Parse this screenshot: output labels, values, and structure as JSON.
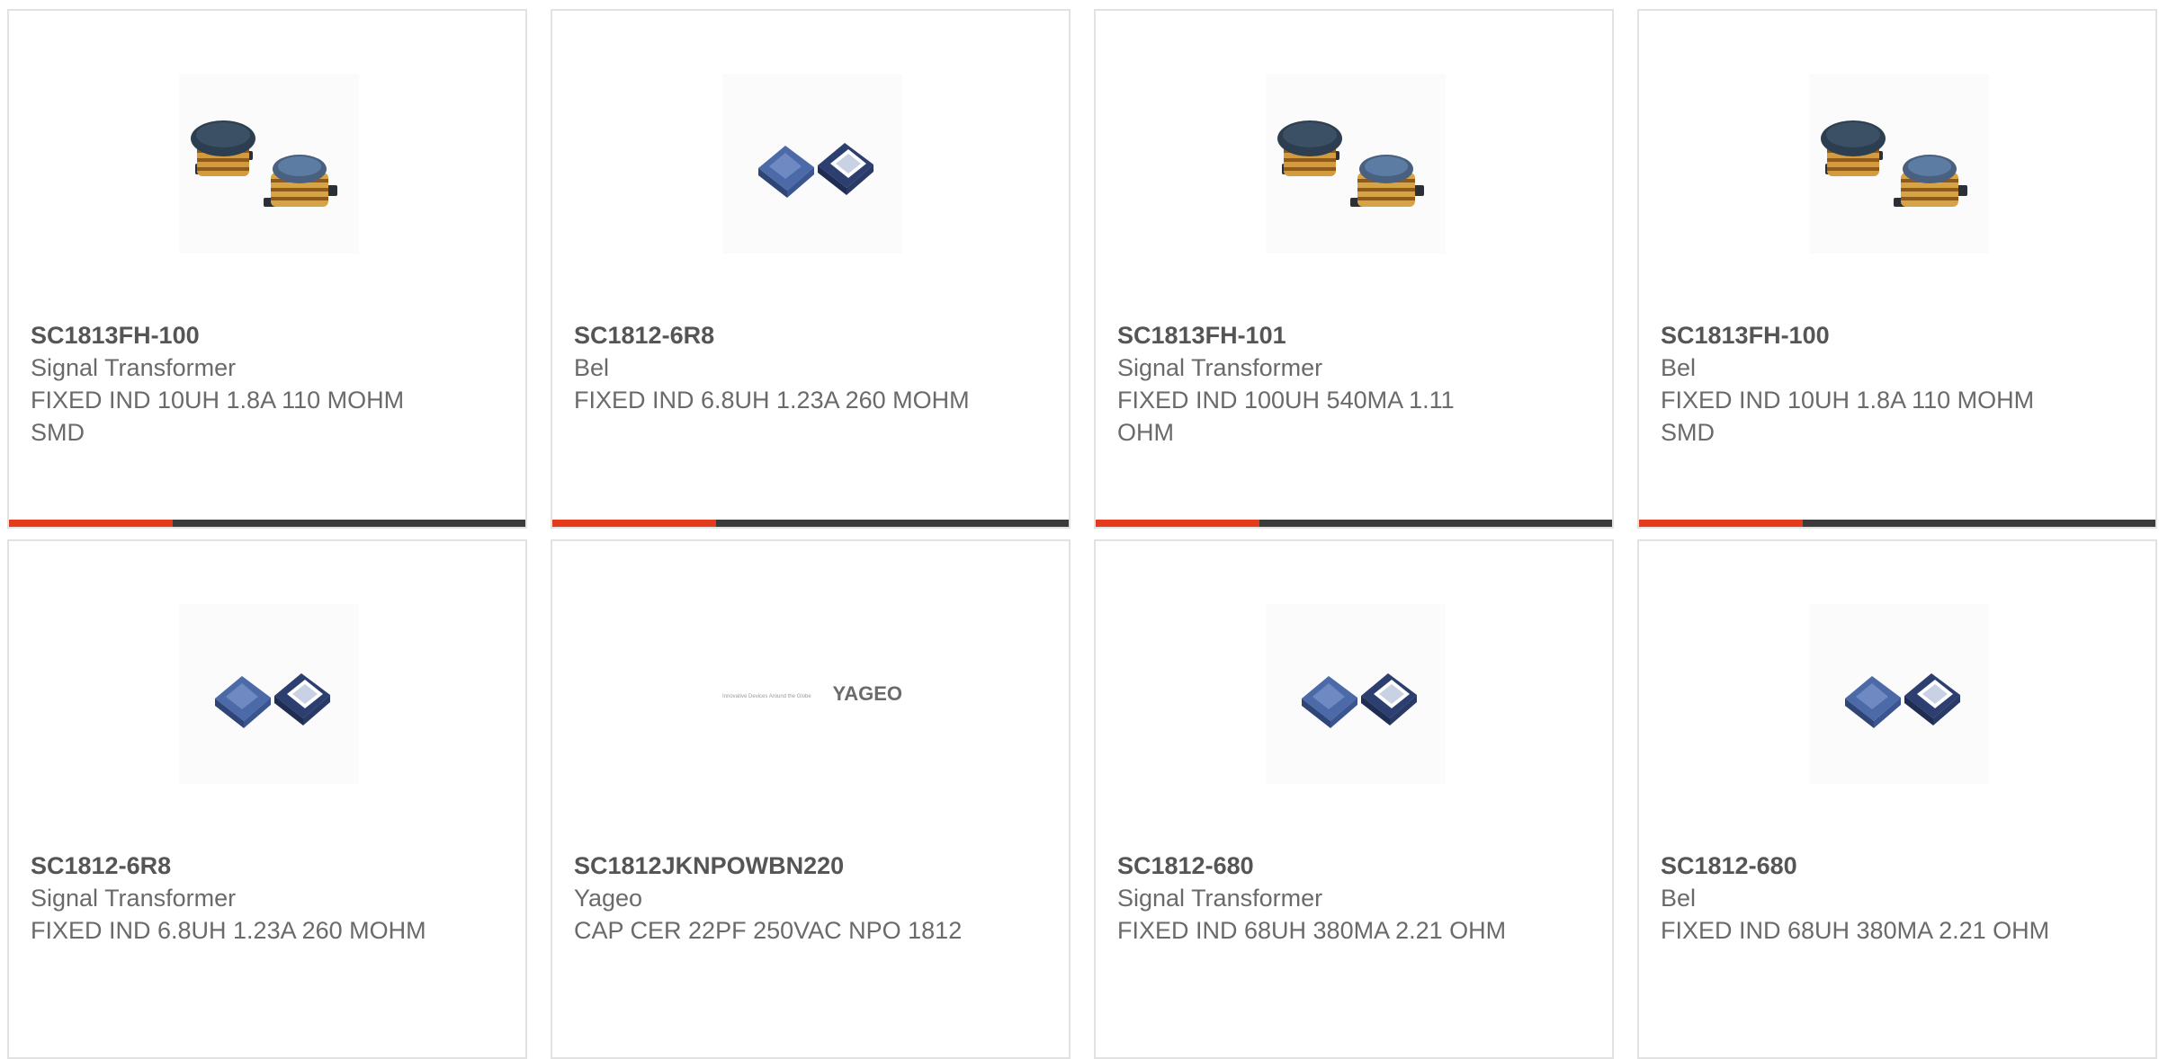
{
  "products": [
    {
      "part": "SC1813FH-100",
      "manufacturer": "Signal Transformer",
      "description": "FIXED IND 10UH 1.8A 110 MOHM SMD",
      "image": "coil-inductor-icon",
      "accent_bar": true
    },
    {
      "part": "SC1812-6R8",
      "manufacturer": "Bel",
      "description": "FIXED IND 6.8UH 1.23A 260 MOHM",
      "image": "chip-inductor-icon",
      "accent_bar": true
    },
    {
      "part": "SC1813FH-101",
      "manufacturer": "Signal Transformer",
      "description": "FIXED IND 100UH 540MA 1.11 OHM",
      "image": "coil-inductor-icon",
      "accent_bar": true
    },
    {
      "part": "SC1813FH-100",
      "manufacturer": "Bel",
      "description": "FIXED IND 10UH 1.8A 110 MOHM SMD",
      "image": "coil-inductor-icon",
      "accent_bar": true
    },
    {
      "part": "SC1812-6R8",
      "manufacturer": "Signal Transformer",
      "description": "FIXED IND 6.8UH 1.23A 260 MOHM",
      "image": "chip-inductor-icon",
      "accent_bar": false
    },
    {
      "part": "SC1812JKNPOWBN220",
      "manufacturer": "Yageo",
      "description": "CAP CER 22PF 250VAC NPO 1812",
      "image": "yageo-logo",
      "accent_bar": false
    },
    {
      "part": "SC1812-680",
      "manufacturer": "Signal Transformer",
      "description": "FIXED IND 68UH 380MA 2.21 OHM",
      "image": "chip-inductor-icon",
      "accent_bar": false
    },
    {
      "part": "SC1812-680",
      "manufacturer": "Bel",
      "description": "FIXED IND 68UH 380MA 2.21 OHM",
      "image": "chip-inductor-icon",
      "accent_bar": false
    }
  ],
  "logo": {
    "brand": "YAGEO",
    "tagline": "Innovative Devices Around the Globe"
  },
  "colors": {
    "accent": "#e33b1b",
    "bar": "#3b3b3b",
    "border": "#e2e2e2",
    "text": "#666666"
  }
}
